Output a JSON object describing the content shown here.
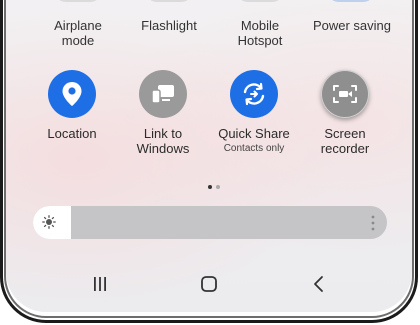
{
  "top_row": [
    {
      "label": "Airplane\nmode"
    },
    {
      "label": "Flashlight"
    },
    {
      "label": "Mobile\nHotspot"
    },
    {
      "label": "Power saving"
    }
  ],
  "tiles": [
    {
      "label": "Location",
      "icon": "location-pin-icon",
      "active": true
    },
    {
      "label": "Link to\nWindows",
      "icon": "link-to-windows-icon",
      "active": false
    },
    {
      "label": "Quick Share",
      "sublabel": "Contacts only",
      "icon": "quick-share-icon",
      "active": true
    },
    {
      "label": "Screen\nrecorder",
      "icon": "screen-recorder-icon",
      "active": false
    }
  ],
  "pager": {
    "pages": 2,
    "current": 1
  },
  "brightness": {
    "icon": "sun-icon",
    "level": 0.1,
    "more_icon": "more-vertical-icon"
  },
  "nav": {
    "recents": "recent-apps-icon",
    "home": "home-icon",
    "back": "back-icon"
  },
  "colors": {
    "accent": "#1e6fe6",
    "inactive": "#9a9a9a"
  }
}
